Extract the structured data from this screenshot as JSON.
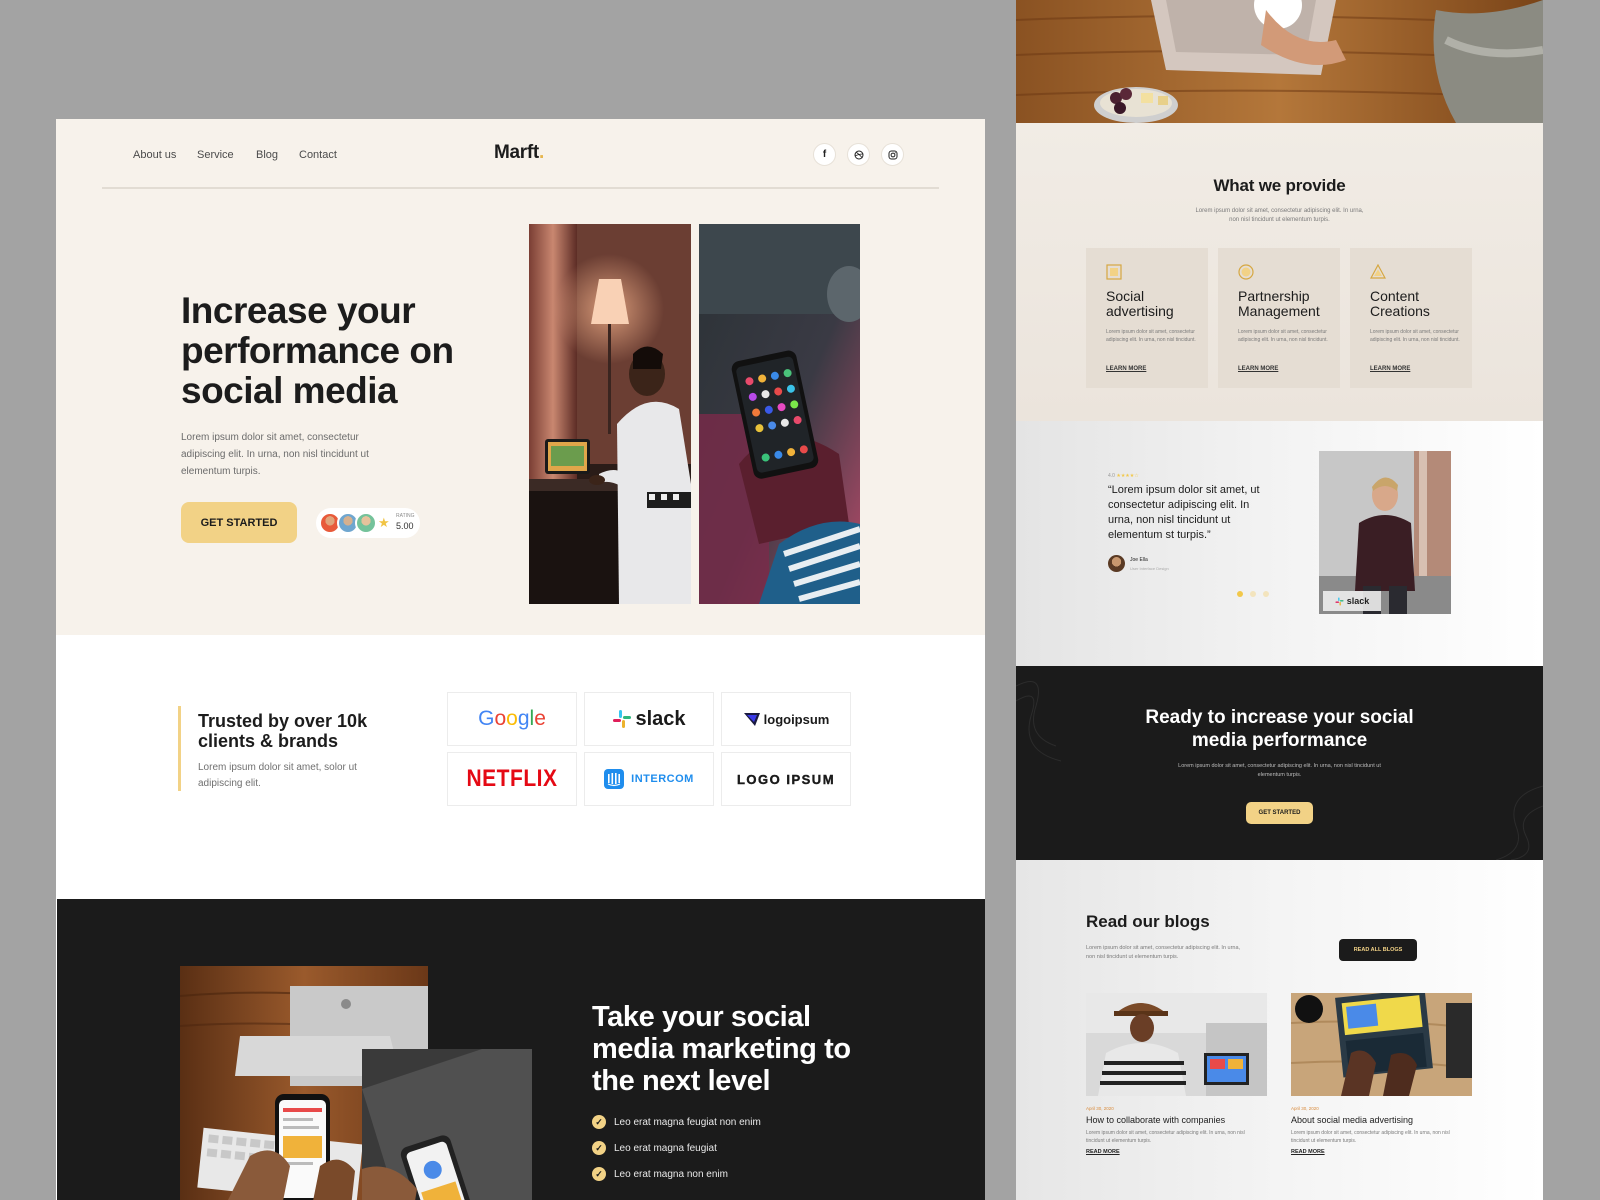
{
  "left": {
    "nav": {
      "about": "About us",
      "service": "Service",
      "blog": "Blog",
      "contact": "Contact"
    },
    "logo": {
      "name": "Marft",
      "dot": "."
    },
    "social_icons": [
      "facebook-icon",
      "dribbble-icon",
      "instagram-icon"
    ],
    "hero": {
      "title": "Increase your performance on social media",
      "description": "Lorem ipsum dolor sit amet, consectetur adipiscing elit. In urna, non nisl tincidunt ut elementum turpis.",
      "cta": "GET STARTED",
      "rating_label": "RATING",
      "rating_value": "5.00"
    },
    "trust": {
      "title": "Trusted by over 10k clients & brands",
      "description": "Lorem ipsum dolor sit amet, solor ut adipiscing elit.",
      "brands": [
        "Google",
        "slack",
        "logoipsum",
        "NETFLIX",
        "INTERCOM",
        "LOGO IPSUM"
      ]
    },
    "marketing": {
      "title": "Take your social media marketing to the next level",
      "checks": [
        "Leo erat magna feugiat non enim",
        "Leo erat magna feugiat",
        "Leo erat magna non enim"
      ]
    }
  },
  "right": {
    "provide": {
      "title": "What we provide",
      "description": "Lorem ipsum dolor sit amet, consectetur adipiscing elit. In urna, non nisl tincidunt ut elementum turpis.",
      "services": [
        {
          "title": "Social advertising",
          "description": "Lorem ipsum dolor sit amet, consectetur adipiscing elit. In urna, non nisl tincidunt.",
          "link": "LEARN MORE"
        },
        {
          "title": "Partnership Management",
          "description": "Lorem ipsum dolor sit amet, consectetur adipiscing elit. In urna, non nisl tincidunt.",
          "link": "LEARN MORE"
        },
        {
          "title": "Content Creations",
          "description": "Lorem ipsum dolor sit amet, consectetur adipiscing elit. In urna, non nisl tincidunt.",
          "link": "LEARN MORE"
        }
      ]
    },
    "testimonial": {
      "rating": "4.0",
      "quote": "“Lorem ipsum dolor sit amet, ut consectetur adipiscing elit. In urna, non nisl tincidunt ut elementum st turpis.”",
      "author": "Joe Ella",
      "role": "User Interface Design",
      "badge": "slack"
    },
    "cta": {
      "title": "Ready to increase your social media performance",
      "description": "Lorem ipsum dolor sit amet, consectetur adipiscing elit. In urna, non nisl tincidunt ut elementum turpis.",
      "button": "GET STARTED"
    },
    "blogs": {
      "title": "Read our blogs",
      "description": "Lorem ipsum dolor sit amet, consectetur adipiscing elit. In urna, non nisl tincidunt ut elementum turpis.",
      "button": "READ ALL BLOGS",
      "posts": [
        {
          "date": "April 30, 2020",
          "title": "How to collaborate with companies",
          "excerpt": "Lorem ipsum dolor sit amet, consectetur adipiscing elit. In urna, non nisl tincidunt ut elementum turpis.",
          "link": "READ MORE"
        },
        {
          "date": "April 30, 2020",
          "title": "About social media advertising",
          "excerpt": "Lorem ipsum dolor sit amet, consectetur adipiscing elit. In urna, non nisl tincidunt ut elementum turpis.",
          "link": "READ MORE"
        }
      ]
    }
  },
  "colors": {
    "accent": "#f2d286",
    "cream": "#f7f2eb",
    "dark": "#1b1b1b",
    "text": "#1c1c1c"
  }
}
